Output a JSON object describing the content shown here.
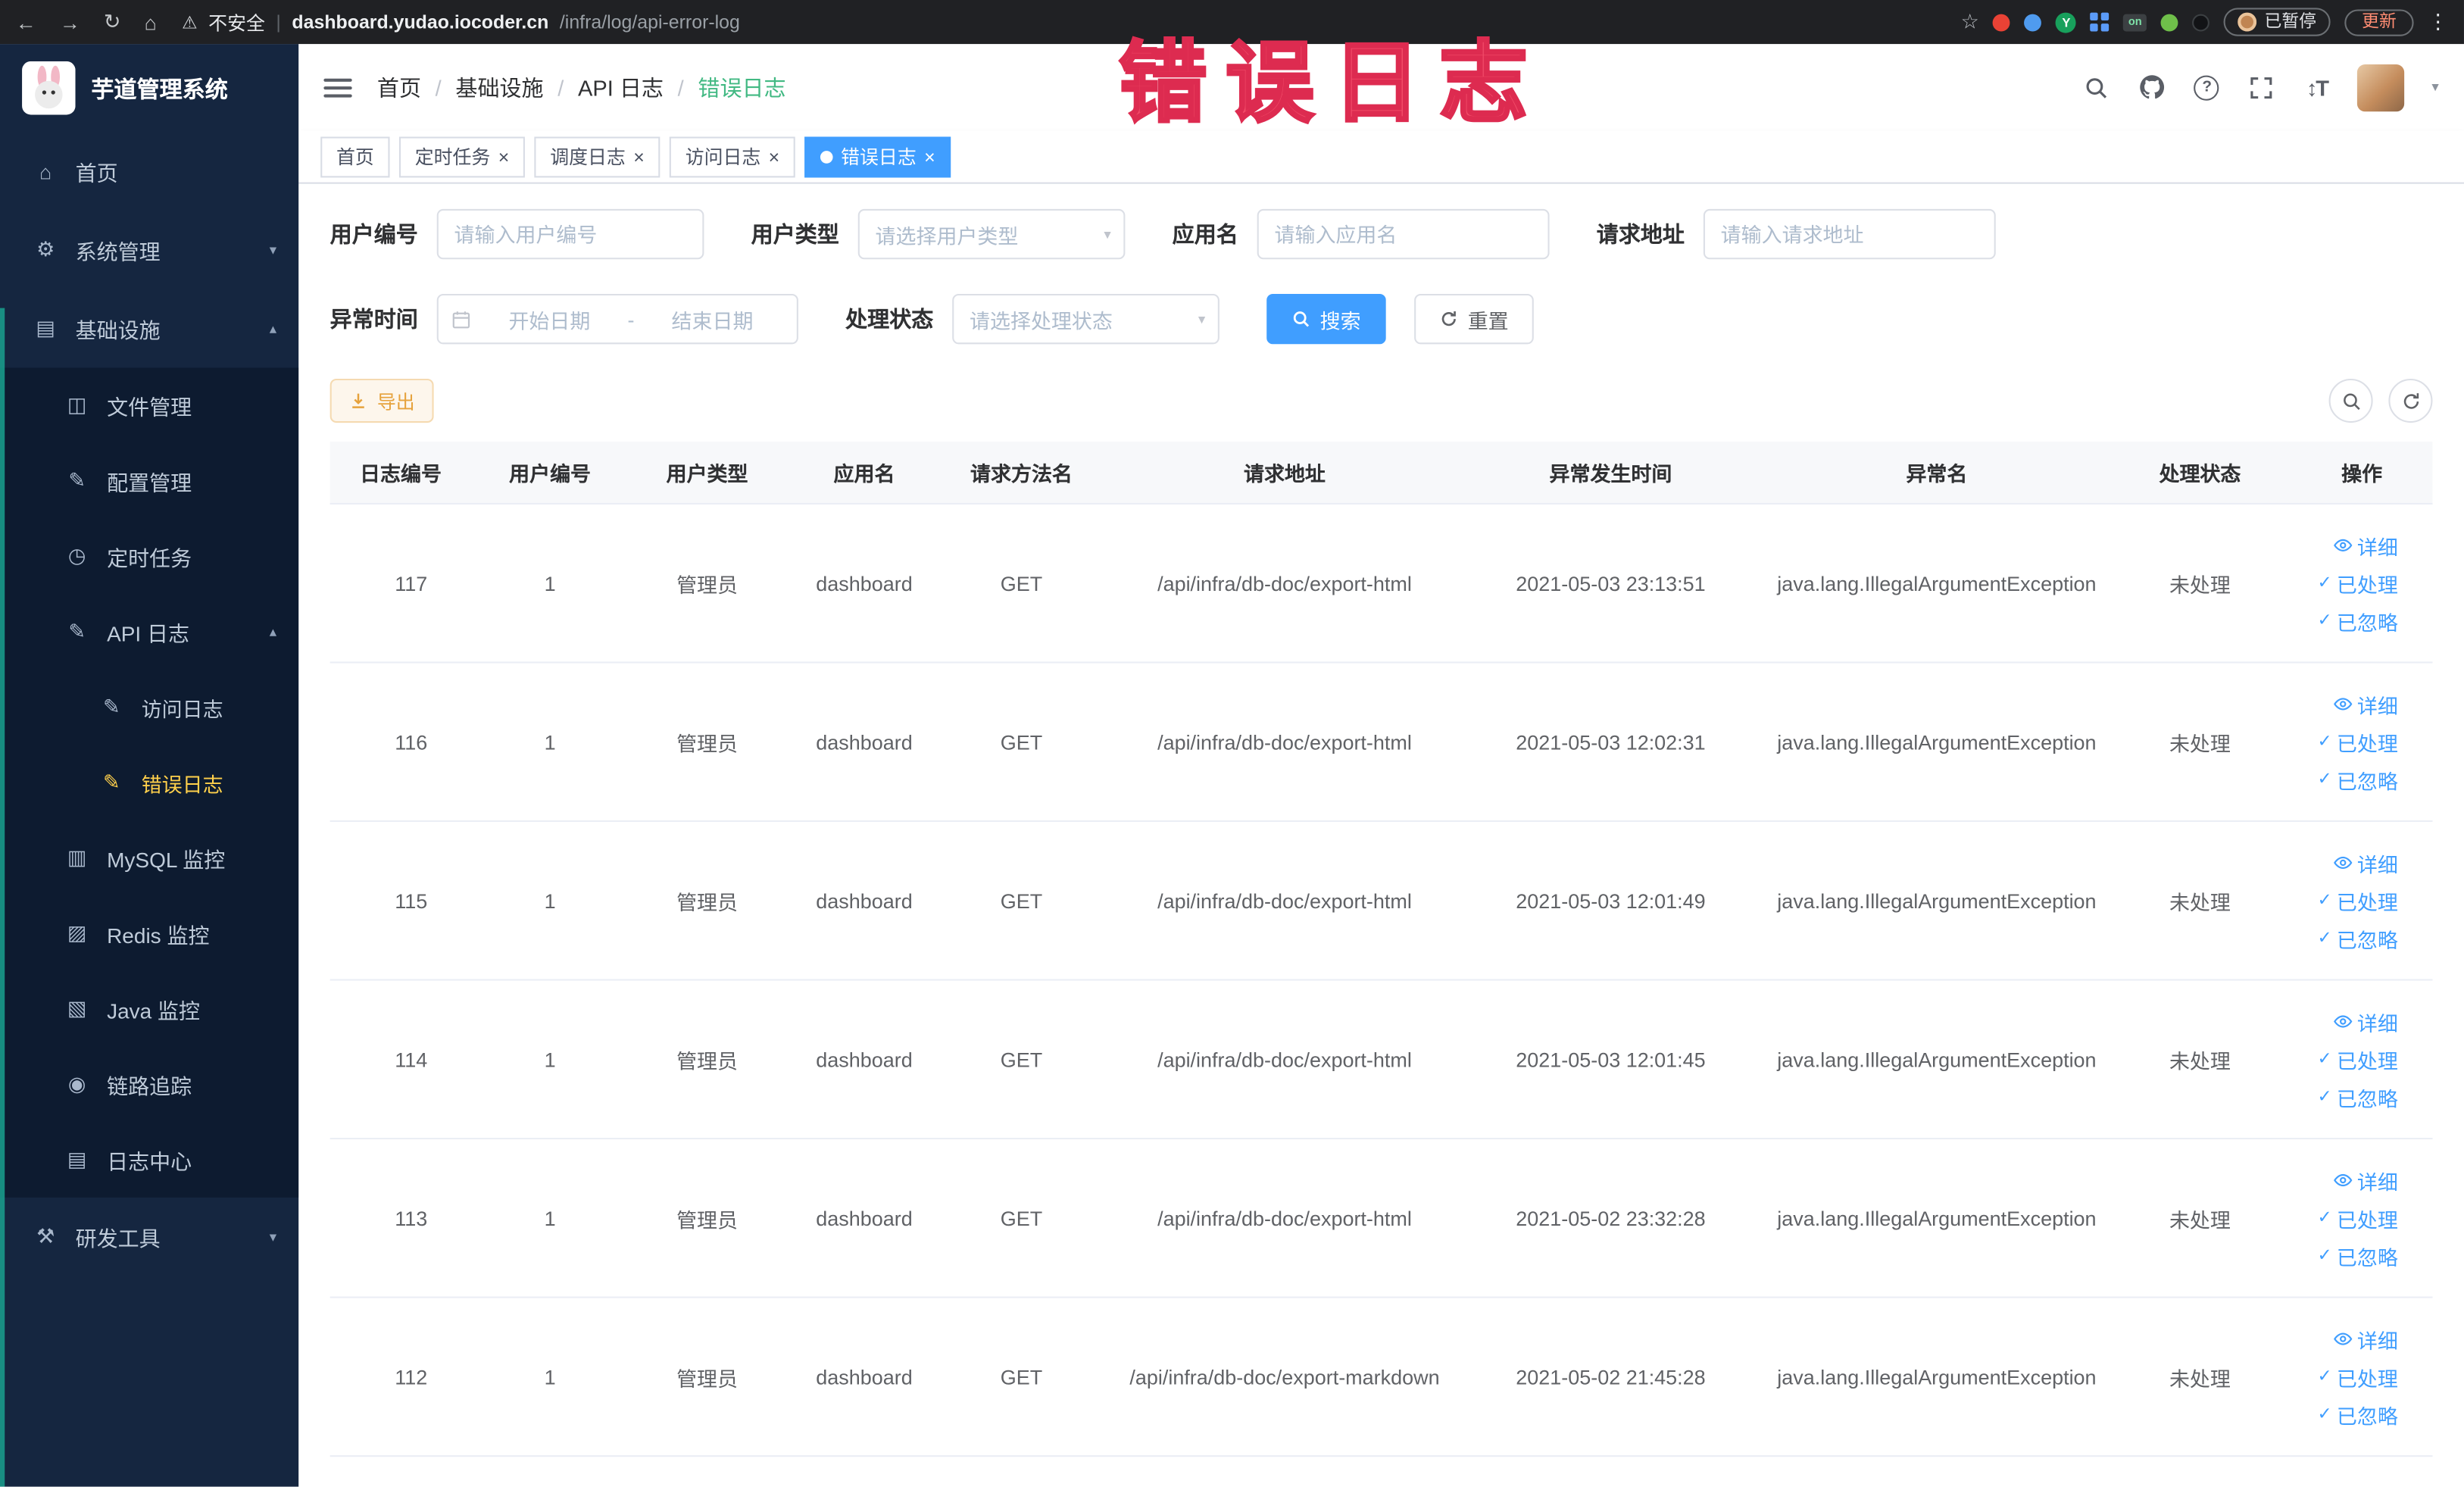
{
  "browser": {
    "security_label": "不安全",
    "url_domain": "dashboard.yudao.iocoder.cn",
    "url_path": "/infra/log/api-error-log",
    "extension_on_badge": "on",
    "paused_badge": "已暂停",
    "update_button": "更新"
  },
  "watermark": "错误日志",
  "sidebar": {
    "logo_title": "芋道管理系统",
    "home": "首页",
    "system_mgmt": "系统管理",
    "infrastructure": "基础设施",
    "file_mgmt": "文件管理",
    "config_mgmt": "配置管理",
    "scheduled_jobs": "定时任务",
    "api_logs": "API 日志",
    "access_log": "访问日志",
    "error_log": "错误日志",
    "mysql_monitor": "MySQL 监控",
    "redis_monitor": "Redis 监控",
    "java_monitor": "Java 监控",
    "link_trace": "链路追踪",
    "log_center": "日志中心",
    "dev_tools": "研发工具"
  },
  "breadcrumb": [
    "首页",
    "基础设施",
    "API 日志",
    "错误日志"
  ],
  "tabs": [
    {
      "label": "首页"
    },
    {
      "label": "定时任务"
    },
    {
      "label": "调度日志"
    },
    {
      "label": "访问日志"
    },
    {
      "label": "错误日志"
    }
  ],
  "filters": {
    "user_id_label": "用户编号",
    "user_id_placeholder": "请输入用户编号",
    "user_type_label": "用户类型",
    "user_type_placeholder": "请选择用户类型",
    "app_name_label": "应用名",
    "app_name_placeholder": "请输入应用名",
    "request_url_label": "请求地址",
    "request_url_placeholder": "请输入请求地址",
    "exception_time_label": "异常时间",
    "date_start_placeholder": "开始日期",
    "date_separator": "-",
    "date_end_placeholder": "结束日期",
    "process_status_label": "处理状态",
    "process_status_placeholder": "请选择处理状态",
    "search_button": "搜索",
    "reset_button": "重置"
  },
  "toolbar": {
    "export_button": "导出"
  },
  "table": {
    "columns": [
      "日志编号",
      "用户编号",
      "用户类型",
      "应用名",
      "请求方法名",
      "请求地址",
      "异常发生时间",
      "异常名",
      "处理状态",
      "操作"
    ],
    "action_labels": [
      "详细",
      "已处理",
      "已忽略"
    ],
    "rows": [
      {
        "id": "117",
        "user_id": "1",
        "user_type": "管理员",
        "app": "dashboard",
        "method": "GET",
        "url": "/api/infra/db-doc/export-html",
        "time": "2021-05-03 23:13:51",
        "exception": "java.lang.IllegalArgumentException",
        "status": "未处理"
      },
      {
        "id": "116",
        "user_id": "1",
        "user_type": "管理员",
        "app": "dashboard",
        "method": "GET",
        "url": "/api/infra/db-doc/export-html",
        "time": "2021-05-03 12:02:31",
        "exception": "java.lang.IllegalArgumentException",
        "status": "未处理"
      },
      {
        "id": "115",
        "user_id": "1",
        "user_type": "管理员",
        "app": "dashboard",
        "method": "GET",
        "url": "/api/infra/db-doc/export-html",
        "time": "2021-05-03 12:01:49",
        "exception": "java.lang.IllegalArgumentException",
        "status": "未处理"
      },
      {
        "id": "114",
        "user_id": "1",
        "user_type": "管理员",
        "app": "dashboard",
        "method": "GET",
        "url": "/api/infra/db-doc/export-html",
        "time": "2021-05-03 12:01:45",
        "exception": "java.lang.IllegalArgumentException",
        "status": "未处理"
      },
      {
        "id": "113",
        "user_id": "1",
        "user_type": "管理员",
        "app": "dashboard",
        "method": "GET",
        "url": "/api/infra/db-doc/export-html",
        "time": "2021-05-02 23:32:28",
        "exception": "java.lang.IllegalArgumentException",
        "status": "未处理"
      },
      {
        "id": "112",
        "user_id": "1",
        "user_type": "管理员",
        "app": "dashboard",
        "method": "GET",
        "url": "/api/infra/db-doc/export-markdown",
        "time": "2021-05-02 21:45:28",
        "exception": "java.lang.IllegalArgumentException",
        "status": "未处理"
      }
    ]
  },
  "colors": {
    "accent": "#409eff",
    "active_tab": "#409eff",
    "menu_active": "#ffd04b",
    "export_button": "#e6a23c",
    "watermark_red": "#f14b68",
    "sidebar_bg": "#152640",
    "submenu_bg": "#0d1b30",
    "chrome_bg": "#202124"
  }
}
